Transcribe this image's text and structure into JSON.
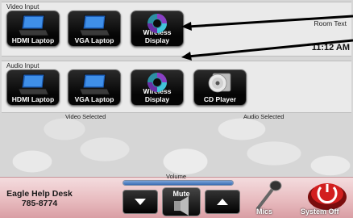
{
  "video_panel": {
    "title": "Video Input",
    "buttons": [
      {
        "label": "HDMI Laptop",
        "icon": "laptop-icon"
      },
      {
        "label": "VGA Laptop",
        "icon": "laptop-icon"
      },
      {
        "label_line1": "Wireless",
        "label_line2": "Display",
        "icon": "wireless-display-icon"
      }
    ]
  },
  "audio_panel": {
    "title": "Audio Input",
    "buttons": [
      {
        "label": "HDMI Laptop",
        "icon": "laptop-icon"
      },
      {
        "label": "VGA Laptop",
        "icon": "laptop-icon"
      },
      {
        "label_line1": "Wireless",
        "label_line2": "Display",
        "icon": "wireless-display-icon"
      },
      {
        "label": "CD Player",
        "icon": "cd-icon"
      }
    ]
  },
  "room_text": "Room Text",
  "clock": "11:12 AM",
  "status": {
    "video_selected": "Video Selected",
    "audio_selected": "Audio Selected"
  },
  "helpdesk": {
    "name": "Eagle Help Desk",
    "phone": "785-8774"
  },
  "volume": {
    "label": "Volume",
    "level_fraction": 1.0,
    "mute_label": "Mute"
  },
  "mics_label": "Mics",
  "system_off_label": "System Off",
  "colors": {
    "bottom_bar": "#e7b9bd",
    "button_bg": "#050505",
    "volume_fill": "#3a6db3",
    "power_red": "#d21f1f"
  }
}
